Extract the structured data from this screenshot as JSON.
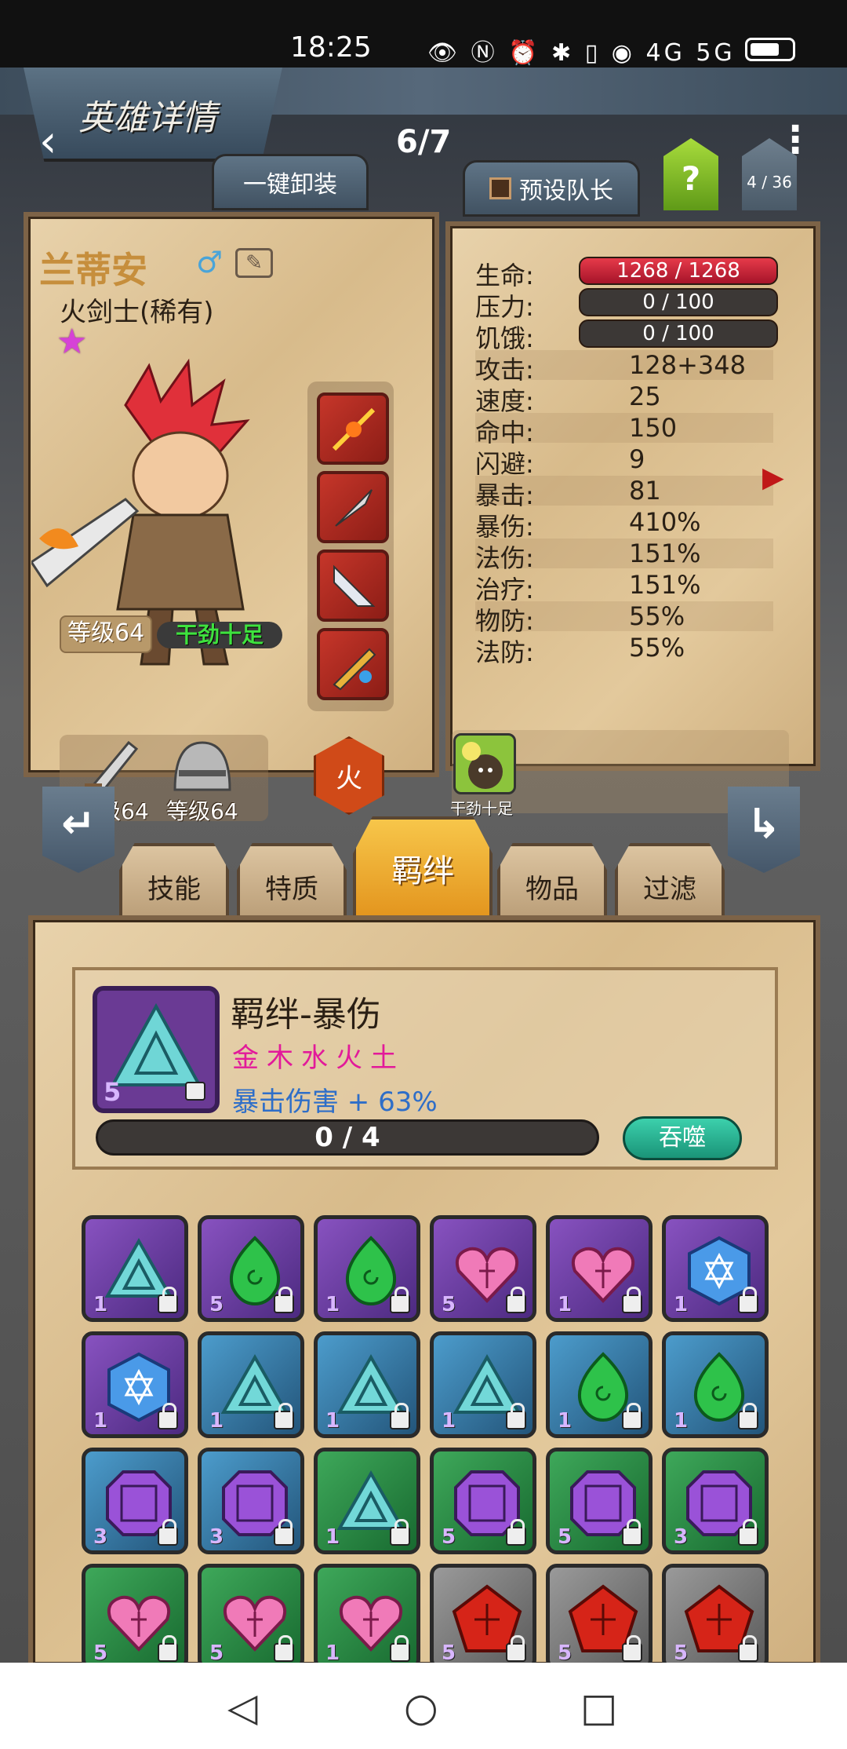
{
  "status_bar": {
    "time": "18:25",
    "icons": "👁 Ⓝ ⏰ ✱ ▯ ◉ 4G 5G"
  },
  "header": {
    "title": "英雄详情",
    "page": "6/7",
    "unequip_all": "一键卸装",
    "preset_leader": "预设队长",
    "help": "?",
    "count": "4 / 36"
  },
  "hero": {
    "name": "兰蒂安",
    "class": "火剑士(稀有)",
    "level": "等级64",
    "mood": "干劲十足",
    "element": "火",
    "gear": [
      {
        "label": "等级64",
        "icon": "sword-icon"
      },
      {
        "label": "等级64",
        "icon": "helmet-icon"
      }
    ]
  },
  "stats": [
    {
      "key": "生命:",
      "value": "1268 / 1268",
      "style": "red"
    },
    {
      "key": "压力:",
      "value": "0 / 100",
      "style": "dark"
    },
    {
      "key": "饥饿:",
      "value": "0 / 100",
      "style": "dark"
    },
    {
      "key": "攻击:",
      "value": "128+348"
    },
    {
      "key": "速度:",
      "value": "25"
    },
    {
      "key": "命中:",
      "value": "150"
    },
    {
      "key": "闪避:",
      "value": "9"
    },
    {
      "key": "暴击:",
      "value": "81"
    },
    {
      "key": "暴伤:",
      "value": "410%"
    },
    {
      "key": "法伤:",
      "value": "151%"
    },
    {
      "key": "治疗:",
      "value": "151%"
    },
    {
      "key": "物防:",
      "value": "55%"
    },
    {
      "key": "法防:",
      "value": "55%"
    }
  ],
  "trait": {
    "label": "干劲十足"
  },
  "tabs": [
    "技能",
    "特质",
    "羁绊",
    "物品",
    "过滤"
  ],
  "bond": {
    "title": "羁绊-暴伤",
    "elements": "金木水火土",
    "effect": "暴击伤害 + 63%",
    "gem_count": "5",
    "progress": "0 / 4",
    "progress_fraction": 0,
    "devour": "吞噬"
  },
  "gems": [
    {
      "frame": "purple",
      "gem": "teal-pyramid",
      "count": "1"
    },
    {
      "frame": "purple",
      "gem": "green-drop",
      "count": "5"
    },
    {
      "frame": "purple",
      "gem": "green-drop",
      "count": "1"
    },
    {
      "frame": "purple",
      "gem": "pink-heart",
      "count": "5"
    },
    {
      "frame": "purple",
      "gem": "pink-heart",
      "count": "1"
    },
    {
      "frame": "purple",
      "gem": "blue-hex",
      "count": "1"
    },
    {
      "frame": "purple",
      "gem": "blue-hex",
      "count": "1"
    },
    {
      "frame": "blue",
      "gem": "teal-pyramid",
      "count": "1"
    },
    {
      "frame": "blue",
      "gem": "teal-pyramid",
      "count": "1"
    },
    {
      "frame": "blue",
      "gem": "teal-pyramid",
      "count": "1"
    },
    {
      "frame": "blue",
      "gem": "green-drop",
      "count": "1"
    },
    {
      "frame": "blue",
      "gem": "green-drop",
      "count": "1"
    },
    {
      "frame": "blue",
      "gem": "purple-octagon",
      "count": "3"
    },
    {
      "frame": "blue",
      "gem": "purple-octagon",
      "count": "3"
    },
    {
      "frame": "green",
      "gem": "teal-pyramid",
      "count": "1"
    },
    {
      "frame": "green",
      "gem": "purple-octagon",
      "count": "5"
    },
    {
      "frame": "green",
      "gem": "purple-octagon",
      "count": "5"
    },
    {
      "frame": "green",
      "gem": "purple-octagon",
      "count": "3"
    },
    {
      "frame": "green",
      "gem": "pink-heart",
      "count": "5"
    },
    {
      "frame": "green",
      "gem": "pink-heart",
      "count": "5"
    },
    {
      "frame": "green",
      "gem": "pink-heart",
      "count": "1"
    },
    {
      "frame": "gray",
      "gem": "red-pentagon",
      "count": "5"
    },
    {
      "frame": "gray",
      "gem": "red-pentagon",
      "count": "5"
    },
    {
      "frame": "gray",
      "gem": "red-pentagon",
      "count": "5"
    }
  ]
}
